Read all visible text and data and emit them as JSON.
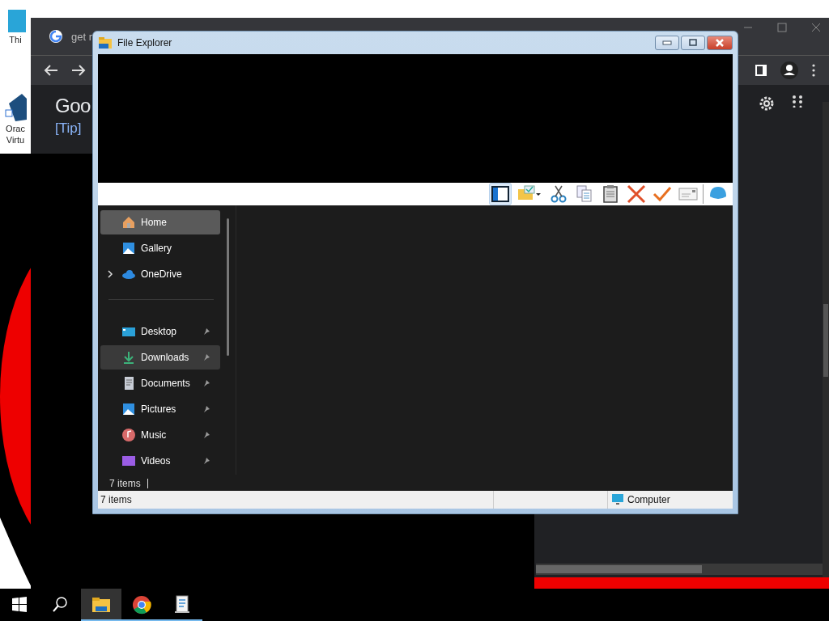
{
  "desktop_icons": [
    {
      "lines": [
        "Thi"
      ]
    },
    {
      "lines": [
        "Orac",
        "Virtu"
      ]
    }
  ],
  "browser": {
    "tab_title": "get r",
    "logo_text": "Goo",
    "link": "[Tip]"
  },
  "explorer": {
    "title": "File Explorer",
    "toolbar": [
      {
        "kind": "pane",
        "selected": true
      },
      {
        "kind": "folder",
        "selected": false
      },
      {
        "kind": "cut",
        "selected": false
      },
      {
        "kind": "copy",
        "selected": false
      },
      {
        "kind": "paste",
        "selected": false
      },
      {
        "kind": "delete",
        "selected": false
      },
      {
        "kind": "confirm",
        "selected": false
      },
      {
        "kind": "mail",
        "selected": false
      },
      {
        "kind": "globe",
        "selected": false
      }
    ],
    "nav_groups": [
      [
        {
          "label": "Home",
          "kind": "home",
          "selected": true,
          "hovered": false,
          "pinned": false,
          "expandable": false
        },
        {
          "label": "Gallery",
          "kind": "gallery",
          "selected": false,
          "hovered": false,
          "pinned": false,
          "expandable": false
        },
        {
          "label": "OneDrive",
          "kind": "cloud",
          "selected": false,
          "hovered": false,
          "pinned": false,
          "expandable": true
        }
      ],
      [
        {
          "label": "Desktop",
          "kind": "desktop",
          "selected": false,
          "hovered": false,
          "pinned": true,
          "expandable": false
        },
        {
          "label": "Downloads",
          "kind": "download",
          "selected": false,
          "hovered": true,
          "pinned": true,
          "expandable": false
        },
        {
          "label": "Documents",
          "kind": "document",
          "selected": false,
          "hovered": false,
          "pinned": true,
          "expandable": false
        },
        {
          "label": "Pictures",
          "kind": "gallery",
          "selected": false,
          "hovered": false,
          "pinned": true,
          "expandable": false
        },
        {
          "label": "Music",
          "kind": "music",
          "selected": false,
          "hovered": false,
          "pinned": true,
          "expandable": false
        },
        {
          "label": "Videos",
          "kind": "video",
          "selected": false,
          "hovered": false,
          "pinned": true,
          "expandable": false
        }
      ]
    ],
    "item_count": "7 items",
    "status_bar": {
      "item_count": "7 items",
      "location": "Computer"
    }
  },
  "taskbar": [
    {
      "kind": "start",
      "selected": false
    },
    {
      "kind": "search",
      "selected": false
    },
    {
      "kind": "explorer",
      "selected": true
    },
    {
      "kind": "chrome",
      "selected": false
    },
    {
      "kind": "notes",
      "selected": false
    }
  ]
}
